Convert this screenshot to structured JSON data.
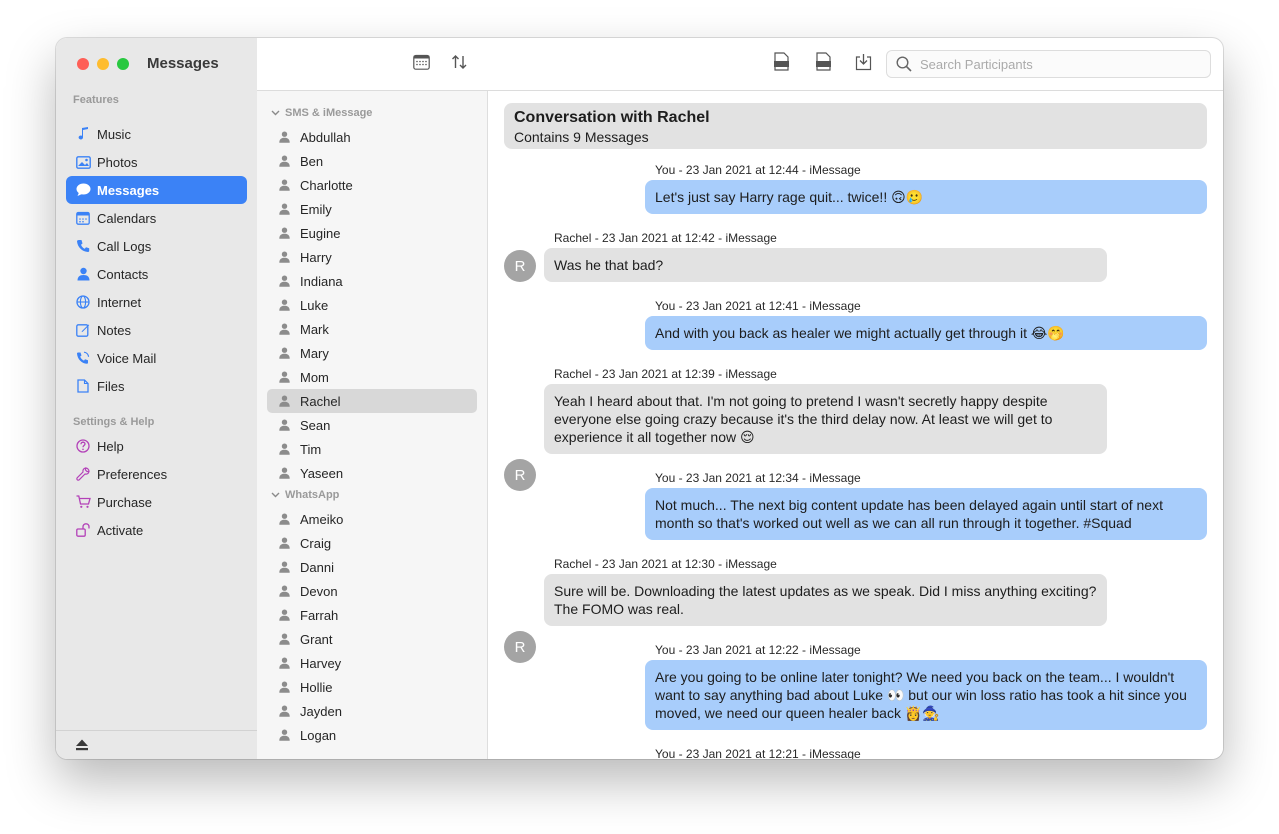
{
  "app": {
    "title": "Messages"
  },
  "sidebar": {
    "features_label": "Features",
    "features": [
      {
        "label": "Music",
        "icon": "music-note-icon"
      },
      {
        "label": "Photos",
        "icon": "photo-icon"
      },
      {
        "label": "Messages",
        "icon": "speech-bubble-icon",
        "active": true
      },
      {
        "label": "Calendars",
        "icon": "calendar-icon"
      },
      {
        "label": "Call Logs",
        "icon": "phone-icon"
      },
      {
        "label": "Contacts",
        "icon": "person-icon"
      },
      {
        "label": "Internet",
        "icon": "globe-icon"
      },
      {
        "label": "Notes",
        "icon": "note-icon"
      },
      {
        "label": "Voice Mail",
        "icon": "voicemail-icon"
      },
      {
        "label": "Files",
        "icon": "file-icon"
      }
    ],
    "settings_label": "Settings & Help",
    "settings": [
      {
        "label": "Help",
        "icon": "question-icon"
      },
      {
        "label": "Preferences",
        "icon": "wrench-icon"
      },
      {
        "label": "Purchase",
        "icon": "cart-icon"
      },
      {
        "label": "Activate",
        "icon": "unlock-icon"
      }
    ]
  },
  "toolbar": {
    "search_placeholder": "Search Participants",
    "icons": [
      "calendar-icon",
      "sort-icon",
      "export-txt-icon",
      "export-pdf-icon",
      "download-icon"
    ]
  },
  "contacts": {
    "groups": [
      {
        "label": "SMS & iMessage",
        "items": [
          "Abdullah",
          "Ben",
          "Charlotte",
          "Emily",
          "Eugine",
          "Harry",
          "Indiana",
          "Luke",
          "Mark",
          "Mary",
          "Mom",
          "Rachel",
          "Sean",
          "Tim",
          "Yaseen"
        ],
        "active": "Rachel"
      },
      {
        "label": "WhatsApp",
        "items": [
          "Ameiko",
          "Craig",
          "Danni",
          "Devon",
          "Farrah",
          "Grant",
          "Harvey",
          "Hollie",
          "Jayden",
          "Logan"
        ]
      }
    ]
  },
  "conversation": {
    "title": "Conversation with Rachel",
    "subtitle": "Contains 9 Messages",
    "messages": [
      {
        "from": "out",
        "meta": "You - 23 Jan 2021 at 12:44 - iMessage",
        "text": "Let's just say Harry rage quit... twice!! 🙃🥲"
      },
      {
        "from": "in",
        "meta": "Rachel - 23 Jan 2021 at 12:42 - iMessage",
        "text": "Was he that bad?",
        "avatar": "R"
      },
      {
        "from": "out",
        "meta": "You - 23 Jan 2021 at 12:41 - iMessage",
        "text": "And with you back as healer we might actually get through it 😂🤭"
      },
      {
        "from": "in",
        "meta": "Rachel - 23 Jan 2021 at 12:39 - iMessage",
        "text": "Yeah I heard about that. I'm not going to pretend I wasn't secretly happy despite everyone else going crazy because it's the third delay now. At least we will get to experience it all together now 😌",
        "avatar": "R"
      },
      {
        "from": "out",
        "meta": "You - 23 Jan 2021 at 12:34 - iMessage",
        "text": "Not much... The next big content update has been delayed again until start of next month so that's worked out well as we can all run through it together. #Squad"
      },
      {
        "from": "in",
        "meta": "Rachel - 23 Jan 2021 at 12:30 - iMessage",
        "text": "Sure will be. Downloading the latest updates as we speak. Did I miss anything exciting? The FOMO was real.",
        "avatar": "R"
      },
      {
        "from": "out",
        "meta": "You - 23 Jan 2021 at 12:22 - iMessage",
        "text": "Are you going to be online later tonight? We need you back on the team... I wouldn't want to say anything bad about Luke 👀 but our win loss ratio has took a hit since you moved, we need our queen healer back 👸🧙"
      },
      {
        "from": "out",
        "meta": "You - 23 Jan 2021 at 12:21 - iMessage",
        "text": ""
      }
    ]
  },
  "colors": {
    "accent": "#3b82f6",
    "outgoing_bubble": "#a8cdfb",
    "incoming_bubble": "#e2e2e2"
  }
}
